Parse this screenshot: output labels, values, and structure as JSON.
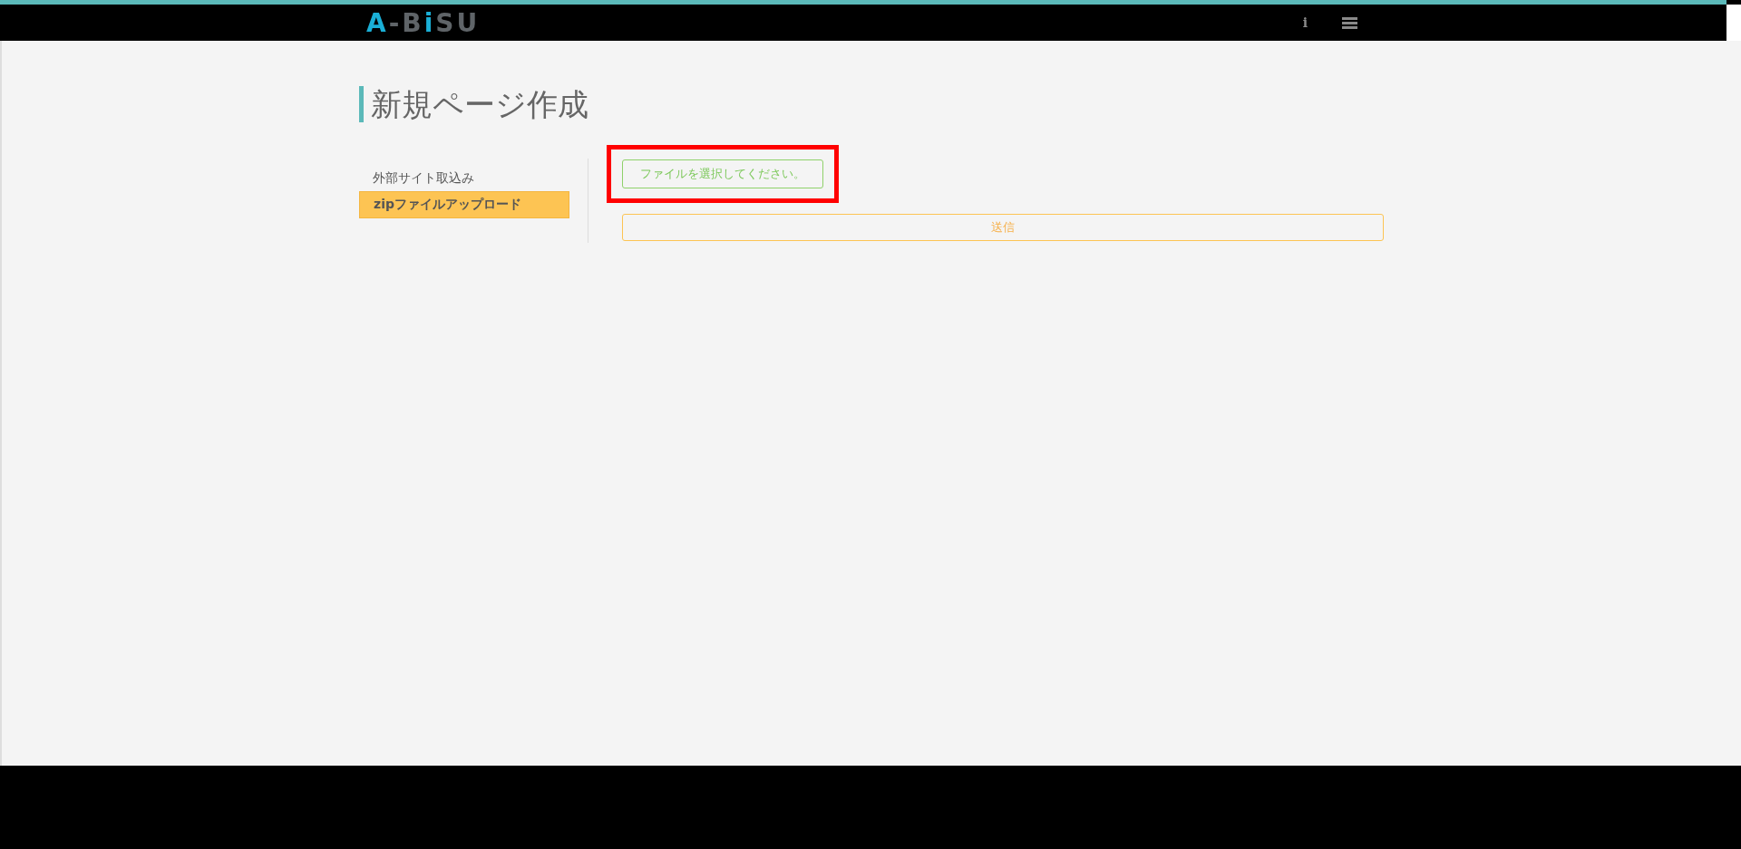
{
  "header": {
    "logo": [
      {
        "text": "A",
        "color": "#1aafd6"
      },
      {
        "text": "-B",
        "color": "#5f6468"
      },
      {
        "text": "i",
        "color": "#1aafd6"
      },
      {
        "text": "SU",
        "color": "#5f6468"
      }
    ],
    "info_icon": "i"
  },
  "page_title": "新規ページ作成",
  "sidebar": {
    "items": [
      {
        "label": "外部サイト取込み",
        "selected": false
      },
      {
        "label": "zipファイルアップロード",
        "selected": true
      }
    ]
  },
  "form": {
    "file_button": {
      "label": "ファイルを選択してください。",
      "highlighted": true
    },
    "submit_button": {
      "label": "送信"
    }
  }
}
